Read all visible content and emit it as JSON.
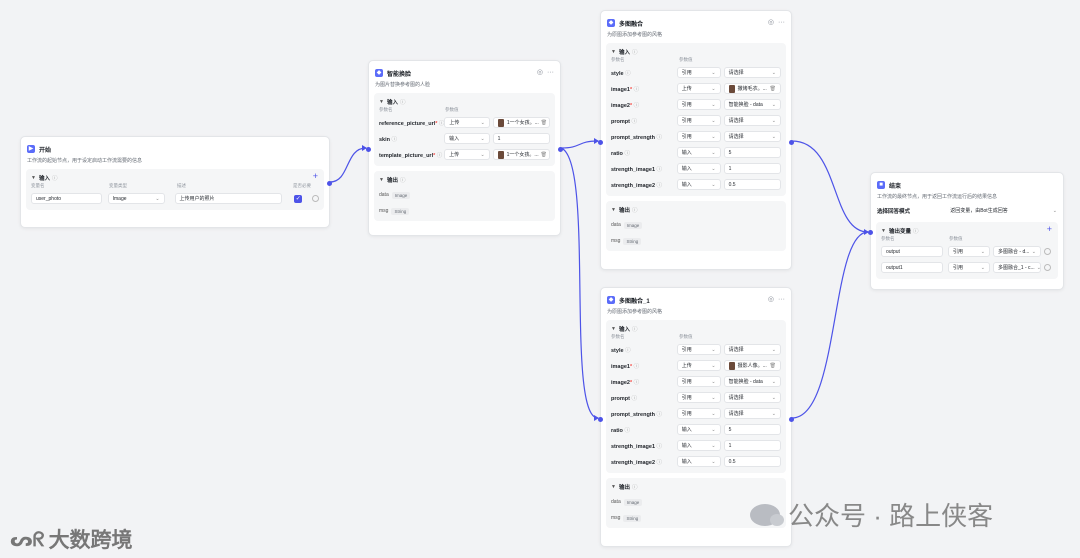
{
  "common": {
    "input_label": "输入",
    "output_label": "输出",
    "param_name_col": "参数名",
    "param_value_col": "参数值",
    "info_icon": "info-icon",
    "more_icon": "more-icon",
    "debug_icon": "debug-icon",
    "dropdown_icon": "chevron-down-icon"
  },
  "start": {
    "title": "开始",
    "desc": "工作流的起始节点，用于设定启动工作流需要的信息",
    "col_var": "变量名",
    "col_type": "变量类型",
    "col_desc": "描述",
    "col_required": "是否必要",
    "var_name": "user_photo",
    "var_type": "Image",
    "var_desc": "上传用户的照片"
  },
  "swap": {
    "title": "智能换脸",
    "desc": "为图片替换参考图的人脸",
    "inputs": [
      {
        "name": "reference_picture_url",
        "required": "*",
        "source": "上传",
        "value": "1一个女孩。..."
      },
      {
        "name": "skin",
        "required": "",
        "source": "输入",
        "value": "1"
      },
      {
        "name": "template_picture_url",
        "required": "*",
        "source": "上传",
        "value": "1一个女孩。..."
      }
    ],
    "outputs": [
      {
        "name": "data",
        "type": "Image"
      },
      {
        "name": "msg",
        "type": "String"
      }
    ]
  },
  "fuse1": {
    "title": "多图融合",
    "desc": "为原图添加参考图的风格",
    "inputs": [
      {
        "name": "style",
        "required": "",
        "source": "引用",
        "value": "请选择"
      },
      {
        "name": "image1",
        "required": "*",
        "source": "上传",
        "value": "撒烤毛衣。..."
      },
      {
        "name": "image2",
        "required": "*",
        "source": "引用",
        "value": "智能换脸 - data"
      },
      {
        "name": "prompt",
        "required": "",
        "source": "引用",
        "value": "请选择"
      },
      {
        "name": "prompt_strength",
        "required": "",
        "source": "引用",
        "value": "请选择"
      },
      {
        "name": "ratio",
        "required": "",
        "source": "输入",
        "value": "5"
      },
      {
        "name": "strength_image1",
        "required": "",
        "source": "输入",
        "value": "1"
      },
      {
        "name": "strength_image2",
        "required": "",
        "source": "输入",
        "value": "0.5"
      }
    ],
    "outputs": [
      {
        "name": "data",
        "type": "Image"
      },
      {
        "name": "msg",
        "type": "String"
      }
    ]
  },
  "fuse2": {
    "title": "多图融合_1",
    "desc": "为原图添加参考图的风格",
    "inputs": [
      {
        "name": "style",
        "required": "",
        "source": "引用",
        "value": "请选择"
      },
      {
        "name": "image1",
        "required": "*",
        "source": "上传",
        "value": "摄影人像。..."
      },
      {
        "name": "image2",
        "required": "*",
        "source": "引用",
        "value": "智能换脸 - data"
      },
      {
        "name": "prompt",
        "required": "",
        "source": "引用",
        "value": "请选择"
      },
      {
        "name": "prompt_strength",
        "required": "",
        "source": "引用",
        "value": "请选择"
      },
      {
        "name": "ratio",
        "required": "",
        "source": "输入",
        "value": "5"
      },
      {
        "name": "strength_image1",
        "required": "",
        "source": "输入",
        "value": "1"
      },
      {
        "name": "strength_image2",
        "required": "",
        "source": "输入",
        "value": "0.5"
      }
    ],
    "outputs": [
      {
        "name": "data",
        "type": "Image"
      },
      {
        "name": "msg",
        "type": "String"
      }
    ]
  },
  "end": {
    "title": "结束",
    "desc": "工作流的最终节点，用于返回工作流运行后的结果信息",
    "mode_label": "选择回答模式",
    "mode_value": "返回变量，由Bot生成回答",
    "out_var_label": "输出变量",
    "vars": [
      {
        "name": "output",
        "source": "引用",
        "value": "多图融合 - d..."
      },
      {
        "name": "output1",
        "source": "引用",
        "value": "多图融合_1 - c..."
      }
    ]
  },
  "watermarks": {
    "bottom_left": "大数跨境",
    "bottom_right": "公众号 · 路上侠客"
  },
  "colors": {
    "accent": "#4d53e8",
    "canvas": "#f2f3f5",
    "required": "#f54a45"
  }
}
